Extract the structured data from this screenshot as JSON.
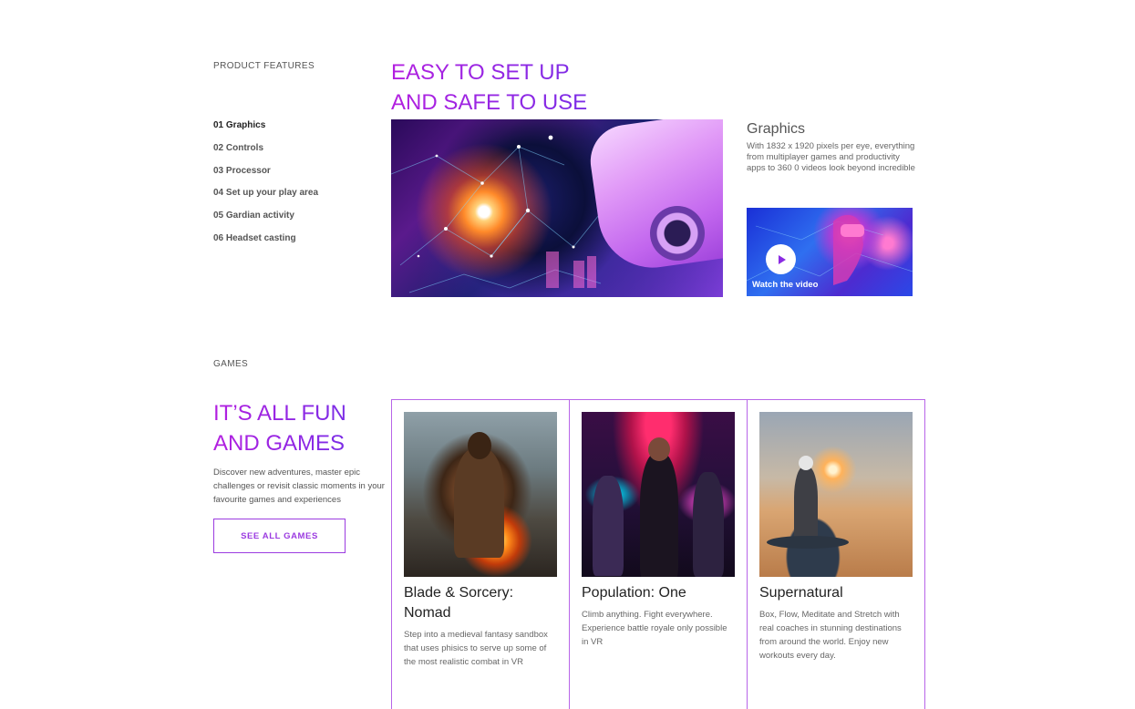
{
  "features": {
    "section_label": "PRODUCT FEATURES",
    "heading_line1": "EASY TO SET UP",
    "heading_line2": "AND SAFE TO USE",
    "items": [
      {
        "label": "01 Graphics",
        "active": true
      },
      {
        "label": "02 Controls",
        "active": false
      },
      {
        "label": "03 Processor",
        "active": false
      },
      {
        "label": "04 Set up your play area",
        "active": false
      },
      {
        "label": "05 Gardian activity",
        "active": false
      },
      {
        "label": "06 Headset casting",
        "active": false
      }
    ],
    "detail_title": "Graphics",
    "detail_description": "With 1832 x 1920 pixels per eye, everything from multiplayer games and productivity apps to 360 0 videos look beyond incredible",
    "video_label": "Watch the video"
  },
  "games": {
    "section_label": "GAMES",
    "heading_line1": "IT’S ALL FUN",
    "heading_line2": "AND GAMES",
    "description": "Discover new adventures, master epic challenges or revisit classic moments in your favourite games and experiences",
    "button_label": "SEE ALL GAMES",
    "cards": [
      {
        "title": "Blade & Sorcery: Nomad",
        "description": "Step into a medieval fantasy sandbox that uses phisics to serve up some of the most realistic combat in VR"
      },
      {
        "title": "Population: One",
        "description": "Climb anything. Fight everywhere. Experience battle royale only possible in VR"
      },
      {
        "title": "Supernatural",
        "description": "Box, Flow, Meditate and Stretch with real coaches in stunning destinations from around the world. Enjoy new workouts every day."
      }
    ]
  },
  "colors": {
    "accent": "#a624e0",
    "card_border": "#b865e8"
  }
}
